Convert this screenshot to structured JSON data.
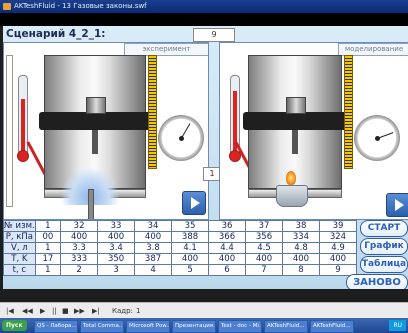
{
  "window": {
    "title": "AKTeshFluid - 13 Газовые законы.swf"
  },
  "app": {
    "scenario_label": "Сценарий 4_2_1:",
    "scenario_number": "9",
    "middle_number": "1",
    "panels": {
      "experiment_label": "эксперимент",
      "modeling_label": "моделирование"
    },
    "table": {
      "row_labels": [
        "№ изм.",
        "P, кПа",
        "V, л",
        "T, K",
        "t, c"
      ],
      "rows": [
        [
          "1",
          "32",
          "33",
          "34",
          "35",
          "36",
          "37",
          "38",
          "39"
        ],
        [
          "00",
          "400",
          "400",
          "400",
          "388",
          "366",
          "356",
          "334",
          "324"
        ],
        [
          "1",
          "3.3",
          "3.4",
          "3.8",
          "4.1",
          "4.4",
          "4.5",
          "4.8",
          "4.9"
        ],
        [
          "17",
          "333",
          "350",
          "387",
          "400",
          "400",
          "400",
          "400",
          "400"
        ],
        [
          "1",
          "2",
          "3",
          "4",
          "5",
          "6",
          "7",
          "8",
          "9"
        ]
      ]
    },
    "buttons": {
      "start": "СТАРТ",
      "graph": "График",
      "table": "Таблица",
      "reset": "ЗАНОВО"
    }
  },
  "player": {
    "frames_label": "Кадр:",
    "frames_value": "1"
  },
  "taskbar": {
    "start_label": "Пуск",
    "items": [
      "QS - Лабора...",
      "Total Comma...",
      "Microsoft Pow...",
      "Презентация...",
      "Test - doc - Mi...",
      "AKTeshFluid...",
      "AKTeshFluid..."
    ],
    "lang": "RU"
  },
  "icons": {
    "window": "flash-icon",
    "play": "play-icon",
    "thermometer": "thermometer-icon",
    "gauge": "pressure-gauge-icon",
    "burner": "gas-burner-icon",
    "spray": "cooling-spray-icon"
  },
  "colors": {
    "accent": "#2a5fbf",
    "panel_bg": "#cfe5f3",
    "thermo": "#d22222",
    "scale": "#f2c600"
  }
}
